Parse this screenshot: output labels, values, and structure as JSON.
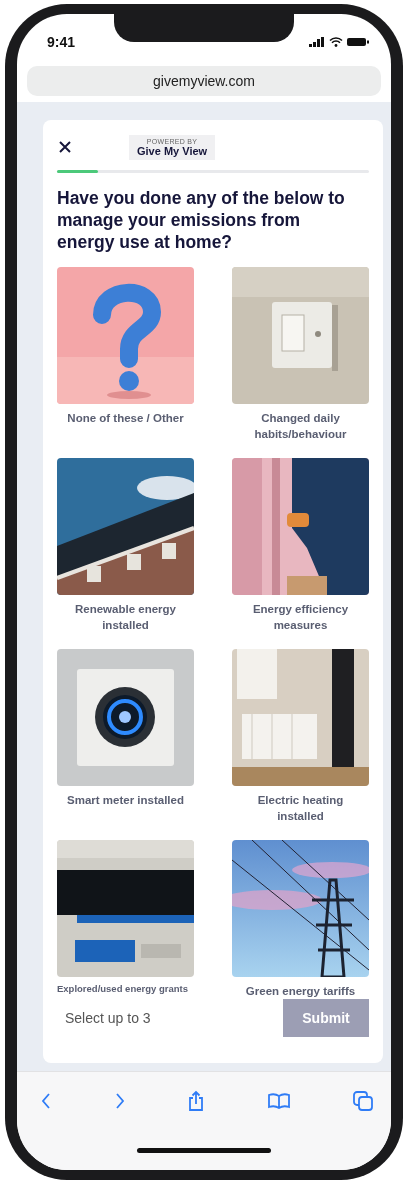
{
  "status_bar": {
    "time": "9:41"
  },
  "browser": {
    "url": "givemyview.com"
  },
  "survey": {
    "badge": {
      "caption": "POWERED BY",
      "brand": "Give My View"
    },
    "progress": {
      "level": 0.13
    },
    "question": "Have you done any of the below to manage your emissions from energy use at home?",
    "options": [
      {
        "label": "None of these / Other",
        "kind": "standard"
      },
      {
        "label": "Changed daily habits/behaviour",
        "kind": "standard"
      },
      {
        "label": "Renewable energy installed",
        "kind": "standard"
      },
      {
        "label": "Energy efficiency measures",
        "kind": "standard"
      },
      {
        "label": "Smart meter installed",
        "kind": "standard"
      },
      {
        "label": "Electric heating installed",
        "kind": "standard"
      },
      {
        "label": "Explored/used energy grants",
        "kind": "compact"
      },
      {
        "label": "Green energy tariffs",
        "kind": "standard"
      }
    ],
    "hint": "Select up to 3",
    "submit": {
      "label": "Submit",
      "disabled": true
    }
  }
}
